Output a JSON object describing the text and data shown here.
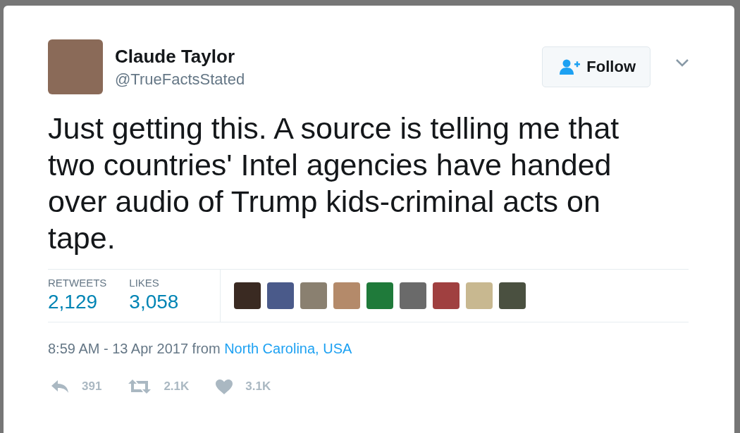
{
  "author": {
    "name": "Claude Taylor",
    "handle": "@TrueFactsStated"
  },
  "follow_button": {
    "label": "Follow"
  },
  "text": "Just getting this. A source is telling me that two countries' Intel agencies have handed over audio of Trump kids-criminal acts on tape.",
  "stats": [
    {
      "label": "RETWEETS",
      "value": "2,129"
    },
    {
      "label": "LIKES",
      "value": "3,058"
    }
  ],
  "meta": {
    "time": "8:59 AM - 13 Apr 2017 from",
    "location": "North Carolina, USA"
  },
  "actions": [
    {
      "kind": "reply",
      "count": "391"
    },
    {
      "kind": "retweet",
      "count": "2.1K"
    },
    {
      "kind": "like",
      "count": "3.1K"
    }
  ]
}
